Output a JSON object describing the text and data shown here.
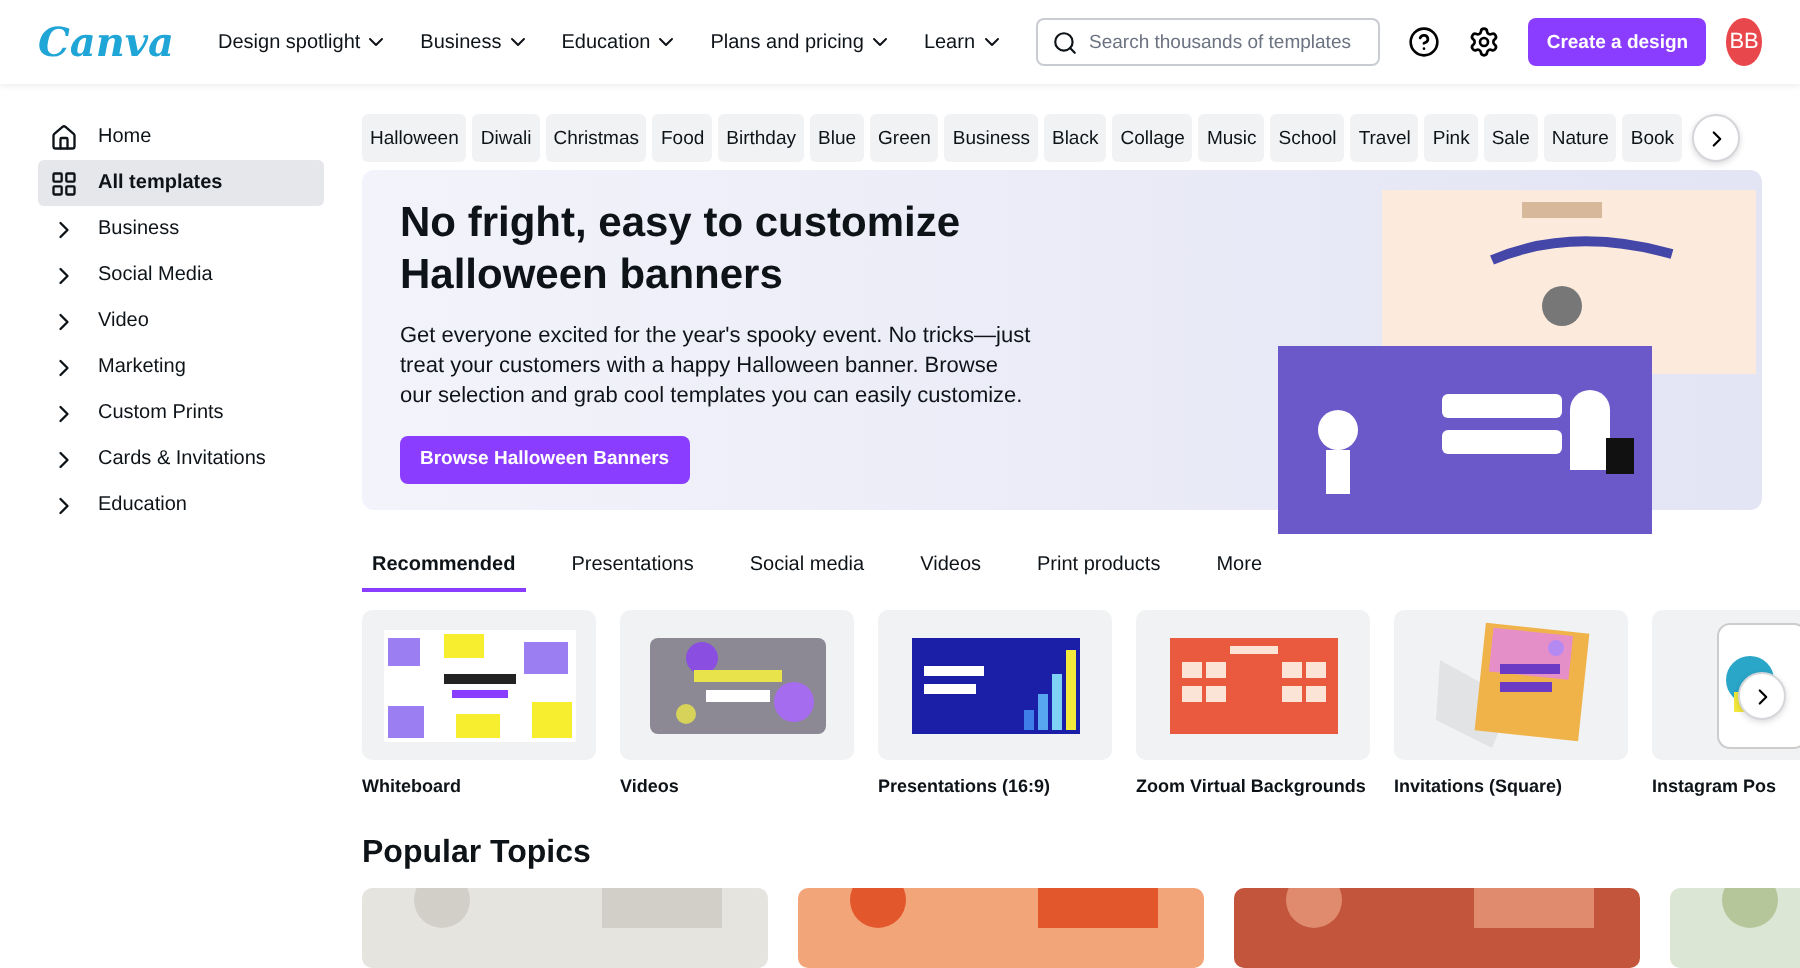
{
  "header": {
    "logo": "Canva",
    "nav": [
      {
        "label": "Design spotlight"
      },
      {
        "label": "Business"
      },
      {
        "label": "Education"
      },
      {
        "label": "Plans and pricing"
      },
      {
        "label": "Learn"
      }
    ],
    "search": {
      "placeholder": "Search thousands of templates"
    },
    "create_button": "Create a design",
    "avatar": "BB"
  },
  "sidebar": {
    "items": [
      {
        "label": "Home",
        "kind": "home",
        "selected": false
      },
      {
        "label": "All templates",
        "kind": "grid",
        "selected": true
      },
      {
        "label": "Business",
        "kind": "expand",
        "selected": false
      },
      {
        "label": "Social Media",
        "kind": "expand",
        "selected": false
      },
      {
        "label": "Video",
        "kind": "expand",
        "selected": false
      },
      {
        "label": "Marketing",
        "kind": "expand",
        "selected": false
      },
      {
        "label": "Custom Prints",
        "kind": "expand",
        "selected": false
      },
      {
        "label": "Cards & Invitations",
        "kind": "expand",
        "selected": false
      },
      {
        "label": "Education",
        "kind": "expand",
        "selected": false
      }
    ]
  },
  "chips": [
    "Halloween",
    "Diwali",
    "Christmas",
    "Food",
    "Birthday",
    "Blue",
    "Green",
    "Business",
    "Black",
    "Collage",
    "Music",
    "School",
    "Travel",
    "Pink",
    "Sale",
    "Nature",
    "Book"
  ],
  "hero": {
    "title": "No fright, easy to customize Halloween banners",
    "text": "Get everyone excited for the year's spooky event. No tricks—just treat your customers with a happy Halloween banner. Browse our selection and grab cool templates you can easily customize.",
    "button": "Browse Halloween Banners"
  },
  "tabs": [
    {
      "label": "Recommended",
      "selected": true
    },
    {
      "label": "Presentations",
      "selected": false
    },
    {
      "label": "Social media",
      "selected": false
    },
    {
      "label": "Videos",
      "selected": false
    },
    {
      "label": "Print products",
      "selected": false
    },
    {
      "label": "More",
      "selected": false
    }
  ],
  "categories": [
    {
      "label": "Whiteboard",
      "kind": "whiteboard"
    },
    {
      "label": "Videos",
      "kind": "video"
    },
    {
      "label": "Presentations (16:9)",
      "kind": "presentation"
    },
    {
      "label": "Zoom Virtual Backgrounds",
      "kind": "zoom"
    },
    {
      "label": "Invitations (Square)",
      "kind": "invitation"
    },
    {
      "label": "Instagram Pos",
      "kind": "instagram"
    }
  ],
  "popular": {
    "title": "Popular Topics"
  }
}
